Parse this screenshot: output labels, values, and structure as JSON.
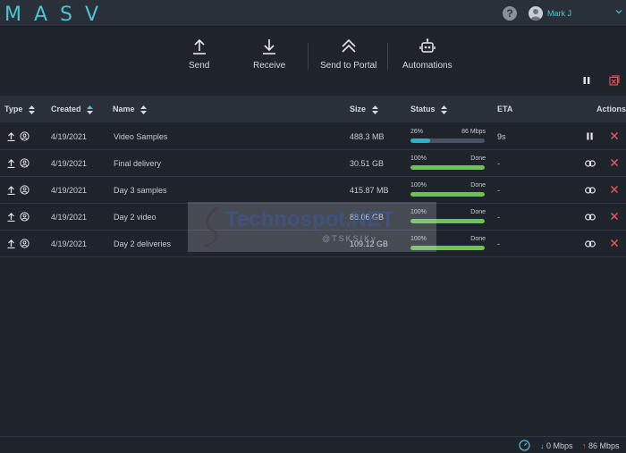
{
  "app": {
    "logo": "MASV"
  },
  "header": {
    "help": "?",
    "user_name": "Mark J",
    "chevron": "⌄"
  },
  "toolbar": {
    "send": "Send",
    "receive": "Receive",
    "send_to_portal": "Send to Portal",
    "automations": "Automations"
  },
  "table": {
    "headers": {
      "type": "Type",
      "created": "Created",
      "name": "Name",
      "size": "Size",
      "status": "Status",
      "eta": "ETA",
      "actions": "Actions"
    },
    "rows": [
      {
        "created": "4/19/2021",
        "name": "Video Samples",
        "size": "488.3 MB",
        "percent": "26%",
        "status_right": "86 Mbps",
        "progress": 0.26,
        "eta": "9s",
        "state": "active"
      },
      {
        "created": "4/19/2021",
        "name": "Final delivery",
        "size": "30.51 GB",
        "percent": "100%",
        "status_right": "Done",
        "progress": 1.0,
        "eta": "-",
        "state": "done"
      },
      {
        "created": "4/19/2021",
        "name": "Day 3 samples",
        "size": "415.87 MB",
        "percent": "100%",
        "status_right": "Done",
        "progress": 1.0,
        "eta": "-",
        "state": "done"
      },
      {
        "created": "4/19/2021",
        "name": "Day 2 video",
        "size": "88.06 GB",
        "percent": "100%",
        "status_right": "Done",
        "progress": 1.0,
        "eta": "-",
        "state": "done"
      },
      {
        "created": "4/19/2021",
        "name": "Day 2 deliveries",
        "size": "109.12 GB",
        "percent": "100%",
        "status_right": "Done",
        "progress": 1.0,
        "eta": "-",
        "state": "done"
      }
    ]
  },
  "watermark": {
    "text": "Technospot.NET",
    "tag": "@TSKSIKy"
  },
  "footer": {
    "down_speed": "0 Mbps",
    "up_speed": "86 Mbps",
    "down_arrow": "↓",
    "up_arrow": "↑"
  },
  "colors": {
    "accent": "#4fc3cf",
    "progress_active": "#2ab3c0",
    "progress_done": "#6fc24a",
    "cancel": "#e05a5a",
    "background": "#1f232b"
  }
}
